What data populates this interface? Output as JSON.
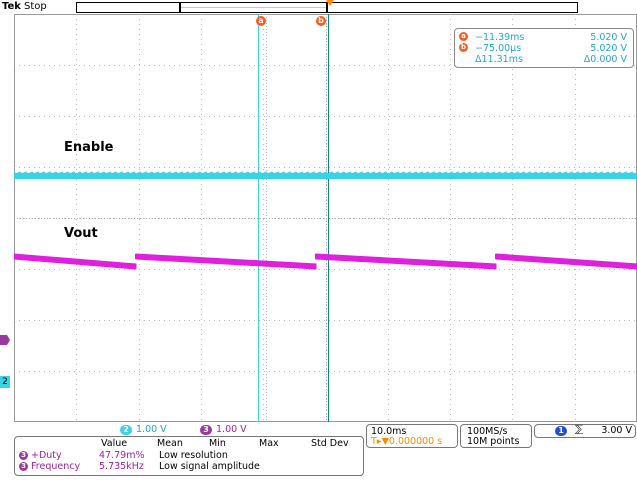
{
  "header": {
    "brand": "Tek",
    "status": "Stop"
  },
  "cursors": {
    "a_label": "a",
    "b_label": "b",
    "readout": {
      "a": {
        "time": "−11.39ms",
        "value": "5.020 V"
      },
      "b": {
        "time": "−75.00µs",
        "value": "5.020 V"
      },
      "delta": {
        "time": "Δ11.31ms",
        "value": "Δ0.000 V"
      }
    }
  },
  "channels": {
    "enable_label": "Enable",
    "vout_label": "Vout",
    "ch2_marker": "2",
    "ch2": {
      "number": "2",
      "scale": "1.00 V"
    },
    "ch3": {
      "number": "3",
      "scale": "1.00 V"
    }
  },
  "measurements": {
    "headers": [
      "Value",
      "Mean",
      "Min",
      "Max",
      "Std Dev"
    ],
    "rows": [
      {
        "chan": "3",
        "name": "+Duty",
        "value": "47.79m%",
        "note": "Low resolution"
      },
      {
        "chan": "3",
        "name": "Frequency",
        "value": "5.735kHz",
        "note": "Low signal amplitude"
      }
    ]
  },
  "timebase": {
    "scale": "10.0ms",
    "trigger_pos": "T▸▼0.000000 s"
  },
  "acquisition": {
    "rate": "100MS/s",
    "points": "10M points"
  },
  "trigger": {
    "chan": "1",
    "slope": "⅀",
    "level": "3.00 V"
  },
  "colors": {
    "ch2": "#39d2e6",
    "ch3": "#e01fe0",
    "cursor_a": "#39d2e6",
    "cursor_b": "#0b8a7a",
    "cursor_badge": "#ff5a1f",
    "trigger": "#ff8c00"
  }
}
